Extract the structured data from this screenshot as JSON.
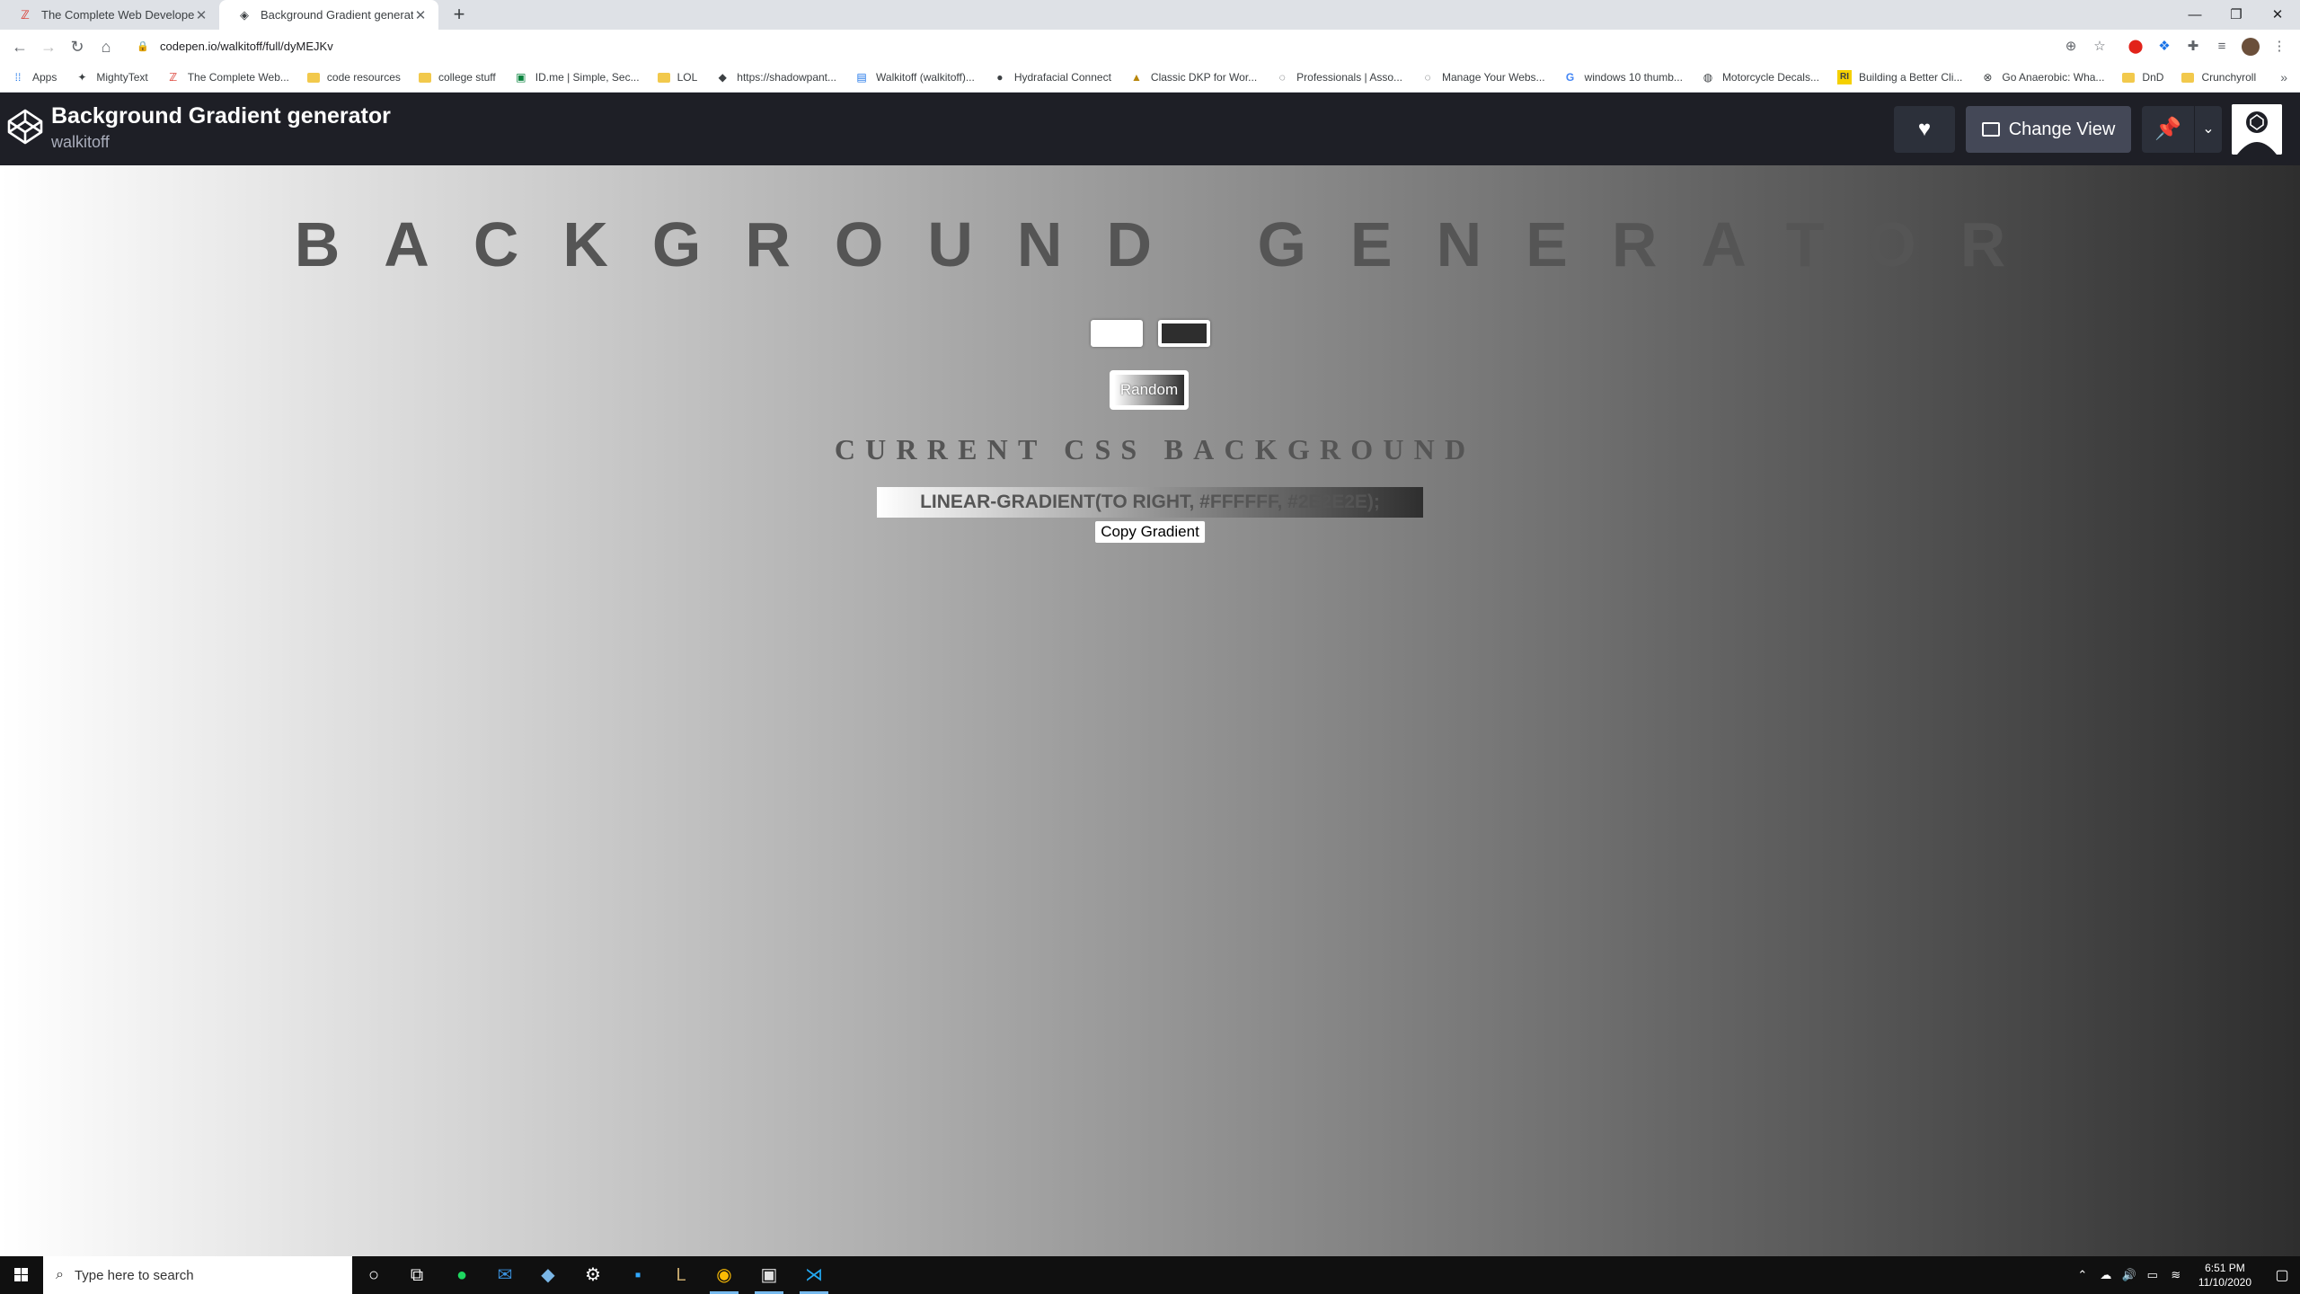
{
  "browser": {
    "tabs": [
      {
        "title": "The Complete Web Developer in",
        "favicon": "ztm-icon"
      },
      {
        "title": "Background Gradient generator",
        "favicon": "codepen-icon"
      }
    ],
    "url": "codepen.io/walkitoff/full/dyMEJKv",
    "bookmarks": [
      {
        "label": "Apps",
        "icon": "apps-grid-icon"
      },
      {
        "label": "MightyText",
        "icon": "mightytext-icon"
      },
      {
        "label": "The Complete Web...",
        "icon": "ztm-icon"
      },
      {
        "label": "code resources",
        "icon": "folder-icon"
      },
      {
        "label": "college stuff",
        "icon": "folder-icon"
      },
      {
        "label": "ID.me | Simple, Sec...",
        "icon": "idme-icon"
      },
      {
        "label": "LOL",
        "icon": "folder-icon"
      },
      {
        "label": "https://shadowpant...",
        "icon": "panther-icon"
      },
      {
        "label": "Walkitoff (walkitoff)...",
        "icon": "im-icon"
      },
      {
        "label": "Hydrafacial Connect",
        "icon": "dot-icon"
      },
      {
        "label": "Classic DKP for Wor...",
        "icon": "wow-icon"
      },
      {
        "label": "Professionals | Asso...",
        "icon": "swirl-icon"
      },
      {
        "label": "Manage Your Webs...",
        "icon": "swirl-icon"
      },
      {
        "label": "windows 10 thumb...",
        "icon": "google-icon"
      },
      {
        "label": "Motorcycle Decals...",
        "icon": "moto-icon"
      },
      {
        "label": "Building a Better Cli...",
        "icon": "ri-icon"
      },
      {
        "label": "Go Anaerobic: Wha...",
        "icon": "x-circle-icon"
      },
      {
        "label": "DnD",
        "icon": "folder-icon"
      },
      {
        "label": "Crunchyroll",
        "icon": "folder-icon"
      }
    ]
  },
  "codepen": {
    "title": "Background Gradient generator",
    "author": "walkitoff",
    "change_view_label": "Change View"
  },
  "app": {
    "heading": "BACKGROUND GENERATOR",
    "color1": "#ffffff",
    "color2": "#2e2e2e",
    "random_label": "Random",
    "css_heading": "CURRENT CSS BACKGROUND",
    "css_value": "linear-gradient(to right, #ffffff, #2e2e2e);",
    "copy_label": "Copy Gradient"
  },
  "taskbar": {
    "search_placeholder": "Type here to search",
    "time": "6:51 PM",
    "date": "11/10/2020"
  }
}
